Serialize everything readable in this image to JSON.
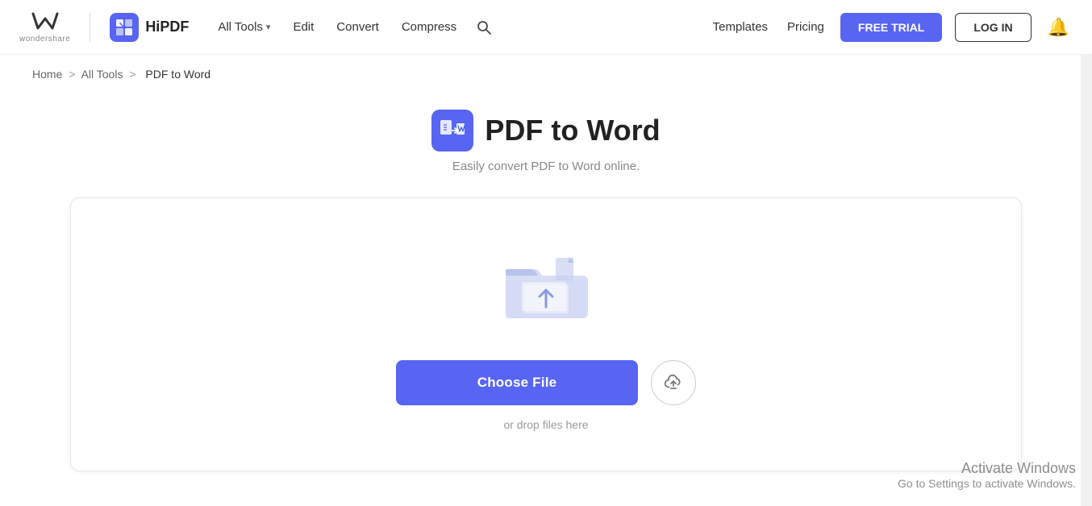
{
  "header": {
    "wondershare_text": "wondershare",
    "hipdf_label": "HiPDF",
    "nav": {
      "all_tools": "All Tools",
      "edit": "Edit",
      "convert": "Convert",
      "compress": "Compress"
    },
    "right_nav": {
      "templates": "Templates",
      "pricing": "Pricing",
      "free_trial": "FREE TRIAL",
      "login": "LOG IN"
    }
  },
  "breadcrumb": {
    "home": "Home",
    "separator1": ">",
    "all_tools": "All Tools",
    "separator2": ">",
    "current": "PDF to Word"
  },
  "page": {
    "title": "PDF to Word",
    "subtitle": "Easily convert PDF to Word online."
  },
  "upload": {
    "choose_file_label": "Choose File",
    "drop_hint": "or drop files here"
  },
  "activate_windows": {
    "title": "Activate Windows",
    "subtitle": "Go to Settings to activate Windows."
  }
}
